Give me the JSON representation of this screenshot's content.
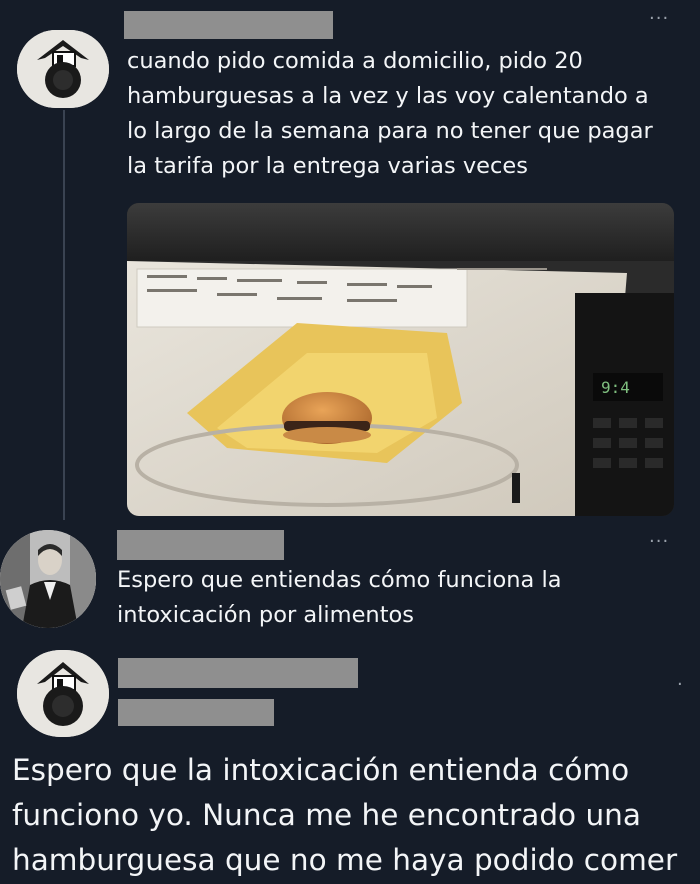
{
  "posts": [
    {
      "text": "cuando pido comida a domicilio, pido 20 hamburguesas a la vez y las voy calentando a lo largo de la semana para no tener que pagar la tarifa por la entrega varias veces",
      "more": "···",
      "media": {
        "display_time": "9:4"
      }
    },
    {
      "text": "Espero que entiendas cómo funciona la intoxicación por alimentos",
      "more": "···"
    },
    {
      "text": "Espero que la intoxicación entienda cómo funciono yo. Nunca me he encontrado una hamburguesa que no me haya podido comer",
      "more": "·"
    }
  ],
  "colors": {
    "background": "#151c28",
    "text": "#f3f5f7",
    "redaction": "#8f8f8f",
    "muted": "#9aa1ab"
  }
}
